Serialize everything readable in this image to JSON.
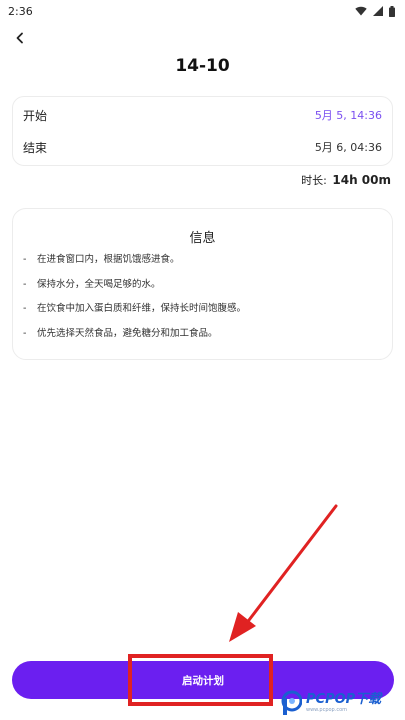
{
  "status_bar": {
    "time": "2:36"
  },
  "header": {
    "title": "14-10"
  },
  "times": {
    "start_label": "开始",
    "start_value": "5月 5, 14:36",
    "end_label": "结束",
    "end_value": "5月 6, 04:36"
  },
  "duration": {
    "label": "时长:",
    "value": "14h 00m"
  },
  "info": {
    "title": "信息",
    "items": [
      "在进食窗口内，根据饥饿感进食。",
      "保持水分，全天喝足够的水。",
      "在饮食中加入蛋白质和纤维，保持长时间饱腹感。",
      "优先选择天然食品，避免糖分和加工食品。"
    ]
  },
  "start_button": {
    "label": "启动计划"
  },
  "watermark": {
    "brand": "PCPOP下载",
    "sub": "www.pcpop.com"
  },
  "colors": {
    "accent": "#7a4ff0",
    "button": "#6b1ff0",
    "annotation_red": "#e02222"
  },
  "icons": [
    "back-arrow-icon",
    "wifi-icon",
    "signal-icon",
    "battery-icon",
    "pcpop-logo-icon"
  ]
}
